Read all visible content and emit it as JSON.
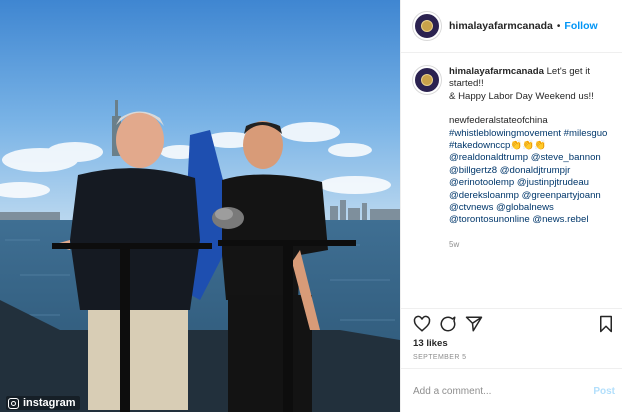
{
  "header": {
    "username": "himalayafarmcanada",
    "separator": "•",
    "follow_label": "Follow"
  },
  "caption": {
    "username": "himalayafarmcanada",
    "line1": "Let's get it started!!",
    "line2": "& Happy Labor Day Weekend us!!",
    "hashtags": [
      "newfederalstateofchina",
      "#whistleblowingmovement #milesguo",
      "#takedownccp👏👏👏",
      "@realdonaldtrump @steve_bannon",
      "@billgertz8 @donaldjtrumpjr",
      "@erinotoolemp @justinpjtrudeau",
      "@dereksloanmp @greenpartyjoann",
      "@ctvnews @globalnews",
      "@torontosunonline @news.rebel"
    ],
    "age": "5w"
  },
  "actions": {
    "icons": [
      "heart-icon",
      "comment-icon",
      "share-icon",
      "bookmark-icon"
    ]
  },
  "likes": "13 likes",
  "date": "SEPTEMBER 5",
  "comment": {
    "placeholder": "Add a comment...",
    "post_label": "Post"
  },
  "watermark": {
    "label": "instagram"
  },
  "colors": {
    "link": "#0095f6",
    "tag": "#00376b",
    "muted": "#8e8e8e",
    "post_disabled": "#b2dffc"
  }
}
